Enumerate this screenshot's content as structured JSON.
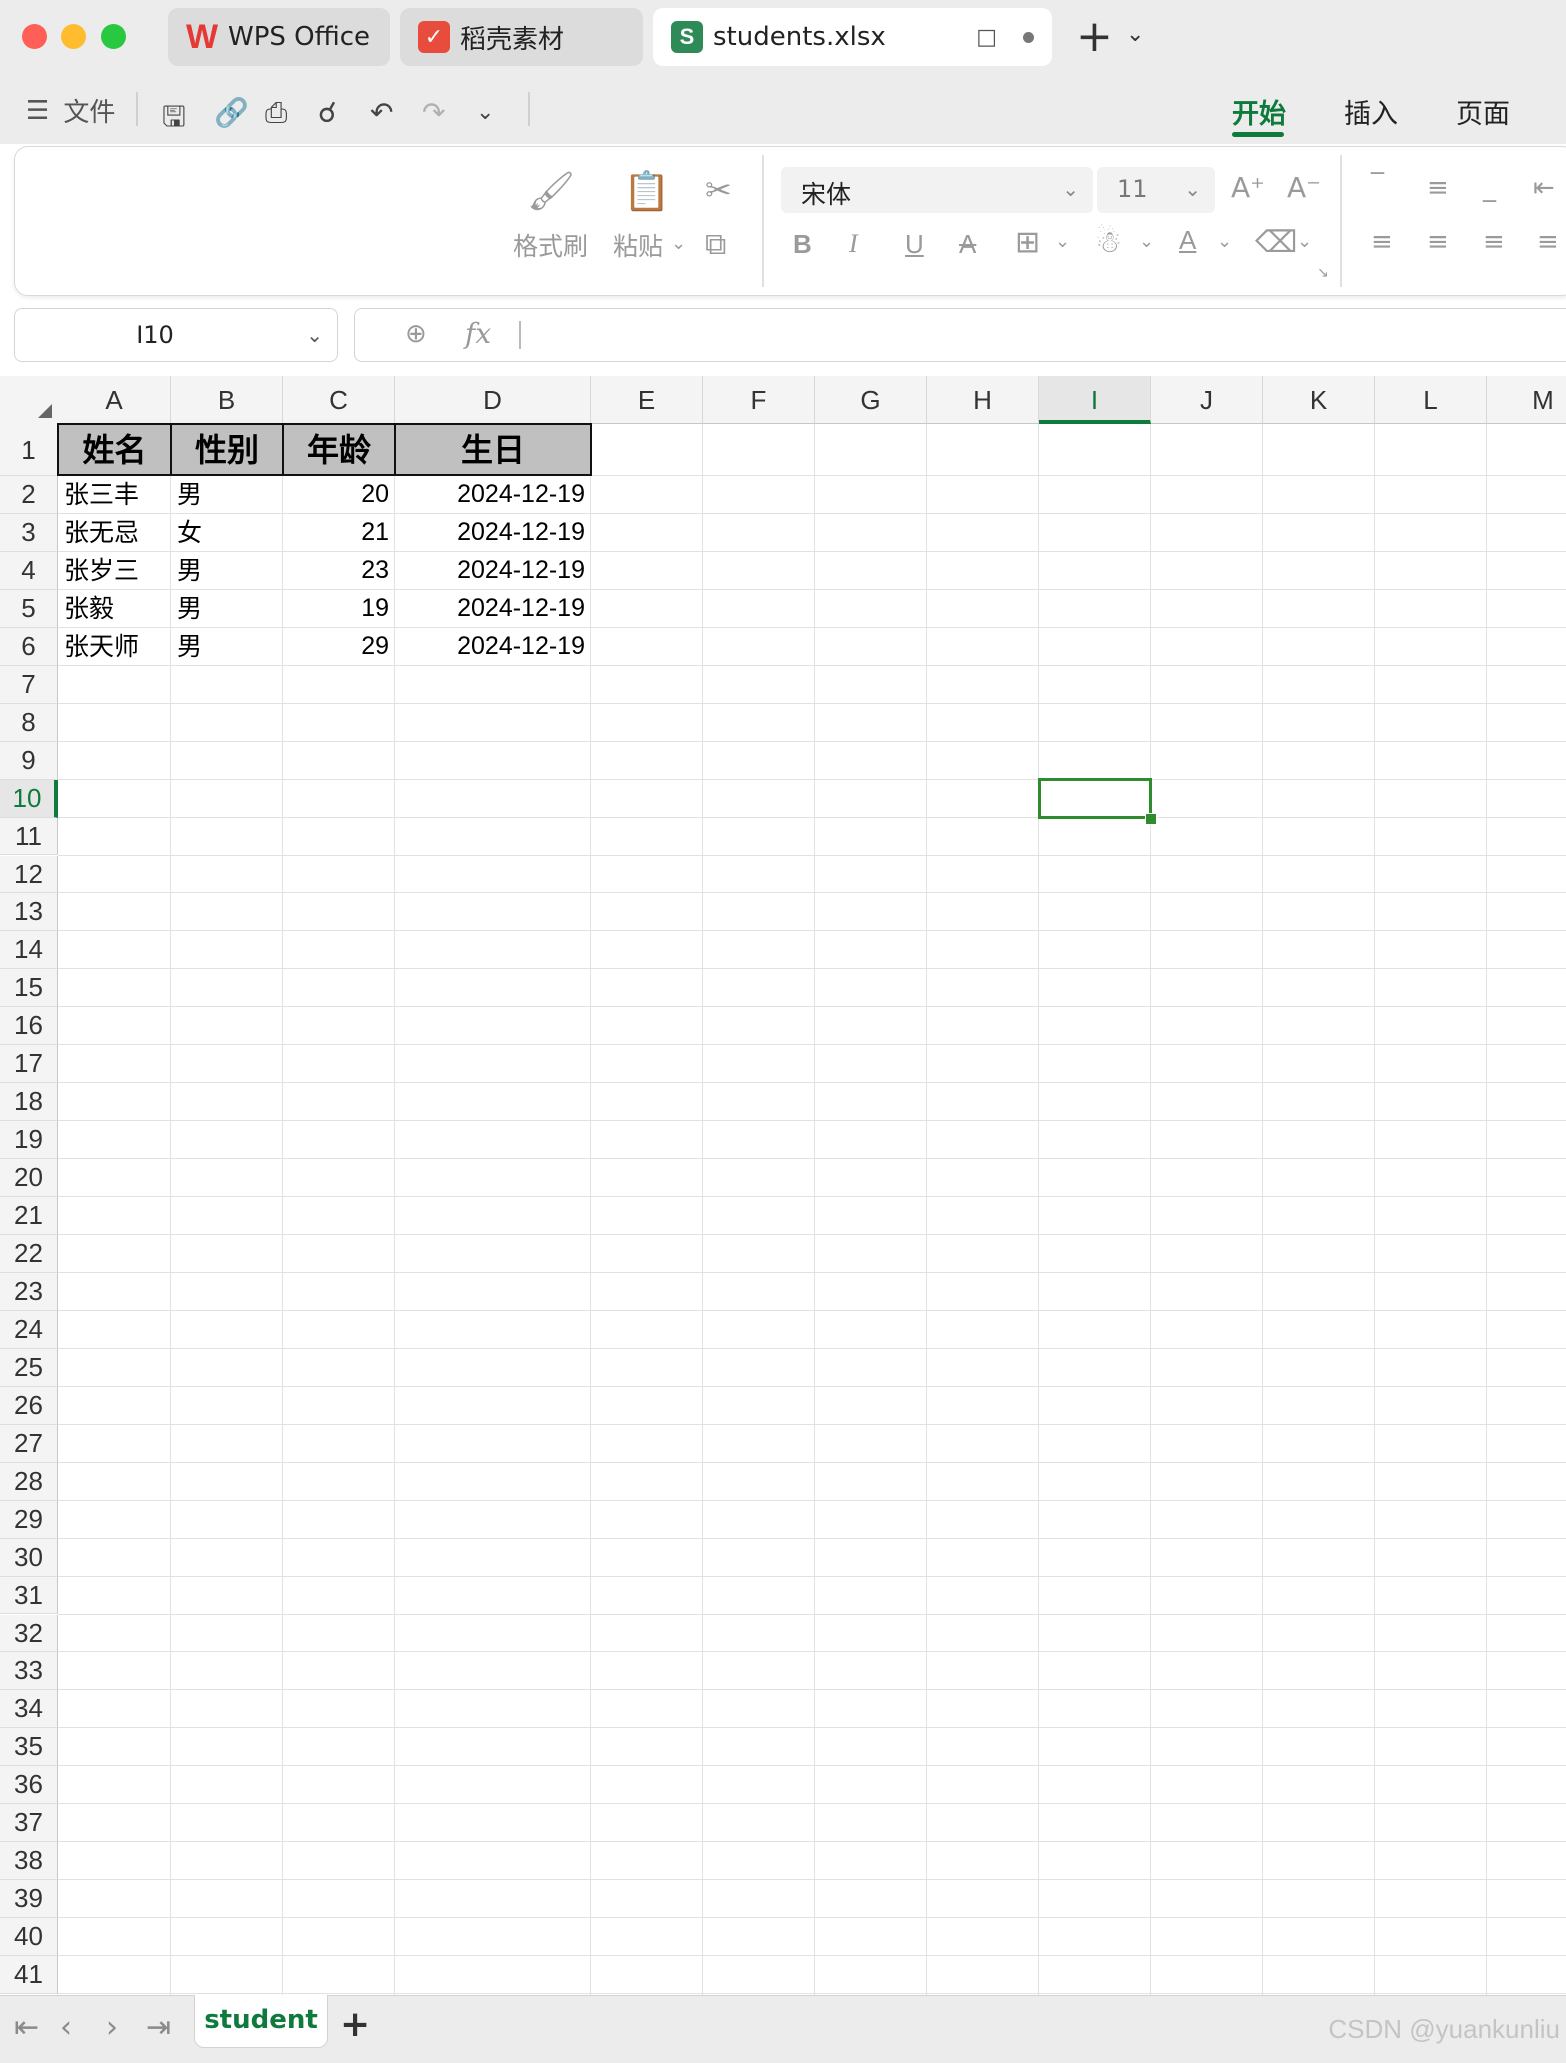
{
  "titlebar": {
    "tabs": [
      {
        "label": "WPS Office",
        "icon": "wps-logo-icon"
      },
      {
        "label": "稻壳素材",
        "icon": "daoke-logo-icon"
      },
      {
        "label": "students.xlsx",
        "icon": "spreadsheet-file-icon",
        "active": true
      }
    ],
    "new_tab": "+"
  },
  "menu": {
    "file": "文件",
    "ribbon_tabs": [
      "开始",
      "插入",
      "页面"
    ],
    "active_tab": "开始"
  },
  "ribbon": {
    "format_painter": "格式刷",
    "paste": "粘贴",
    "font_name": "宋体",
    "font_size": "11"
  },
  "formula_bar": {
    "name_box": "I10",
    "fx": "fx",
    "content": ""
  },
  "sheet": {
    "columns": [
      "A",
      "B",
      "C",
      "D",
      "E",
      "F",
      "G",
      "H",
      "I",
      "J",
      "K",
      "L",
      "M"
    ],
    "selected_column": "I",
    "selected_row": 10,
    "header": [
      "姓名",
      "性别",
      "年龄",
      "生日"
    ],
    "rows": [
      [
        "张三丰",
        "男",
        "20",
        "2024-12-19"
      ],
      [
        "张无忌",
        "女",
        "21",
        "2024-12-19"
      ],
      [
        "张岁三",
        "男",
        "23",
        "2024-12-19"
      ],
      [
        "张毅",
        "男",
        "19",
        "2024-12-19"
      ],
      [
        "张天师",
        "男",
        "29",
        "2024-12-19"
      ]
    ],
    "row_count": 41
  },
  "sheet_tabs": {
    "tabs": [
      "student"
    ],
    "add": "+"
  },
  "watermark": "CSDN @yuankunliu",
  "colors": {
    "accent": "#0e7a3c",
    "selection": "#2e8b2e",
    "header_fill": "#c0c0c0"
  }
}
